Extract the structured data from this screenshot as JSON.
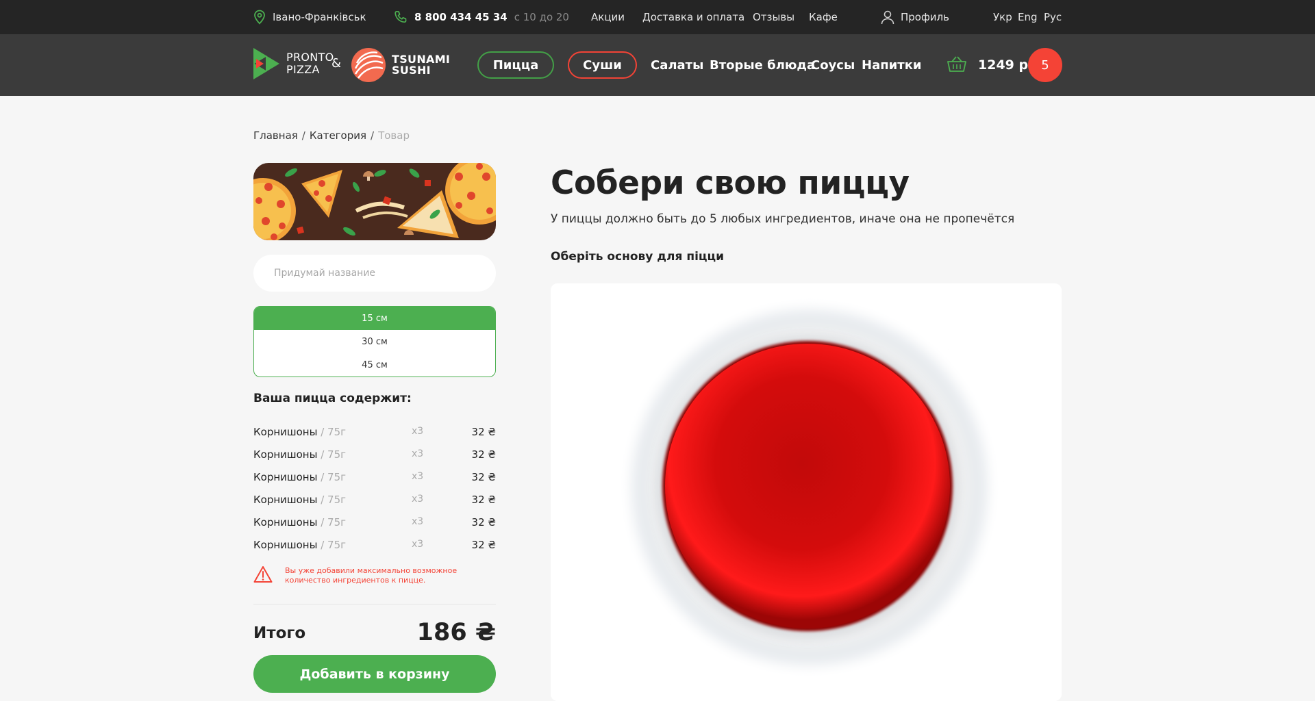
{
  "topbar": {
    "city": "Івано-Франківськ",
    "phone": "8 800 434 45 34",
    "hours": "с 10 до 20",
    "nav": [
      {
        "label": "Акции"
      },
      {
        "label": "Доставка и оплата"
      },
      {
        "label": "Отзывы"
      },
      {
        "label": "Кафе"
      }
    ],
    "profile": "Профиль",
    "languages": [
      "Укр",
      "Eng",
      "Рус"
    ]
  },
  "header": {
    "logo_pronto": [
      "PRONTO",
      "PIZZA"
    ],
    "amp": "&",
    "logo_tsunami": [
      "TSUNAMI",
      "SUSHI"
    ],
    "pill_pizza": "Пицца",
    "pill_sushi": "Суши",
    "nav": [
      {
        "label": "Салаты"
      },
      {
        "label": "Вторые блюда"
      },
      {
        "label": "Соусы"
      },
      {
        "label": "Напитки"
      }
    ],
    "cart_total": "1249 р",
    "cart_count": "5"
  },
  "breadcrumb": {
    "home": "Главная",
    "category": "Категория",
    "current": "Товар",
    "sep": "/"
  },
  "builder": {
    "name_placeholder": "Придумай название",
    "sizes": [
      "15 см",
      "30 см",
      "45 см"
    ],
    "selected_size": "15 см",
    "contains_title": "Ваша пицца содержит:",
    "ingredients": [
      {
        "name": "Корнишоны",
        "weight": " / 75г",
        "qty": "x3",
        "price": "32 ₴"
      },
      {
        "name": "Корнишоны",
        "weight": " / 75г",
        "qty": "x3",
        "price": "32 ₴"
      },
      {
        "name": "Корнишоны",
        "weight": " / 75г",
        "qty": "x3",
        "price": "32 ₴"
      },
      {
        "name": "Корнишоны",
        "weight": " / 75г",
        "qty": "x3",
        "price": "32 ₴"
      },
      {
        "name": "Корнишоны",
        "weight": " / 75г",
        "qty": "x3",
        "price": "32 ₴"
      },
      {
        "name": "Корнишоны",
        "weight": " / 75г",
        "qty": "x3",
        "price": "32 ₴"
      }
    ],
    "warning": "Вы уже добавили максимально возможное количество ингредиентов к пицце.",
    "total_label": "Итого",
    "total_value": "186 ₴",
    "add_button": "Добавить в корзину"
  },
  "main": {
    "title": "Собери свою пиццу",
    "subtitle": "У пиццы должно быть до 5 любых ингредиентов, иначе она не пропечётся",
    "base_title": "Оберіть основу для піцци"
  },
  "colors": {
    "accent_green": "#4caf50",
    "accent_red": "#f44336",
    "topbar_bg": "#252525",
    "header_bg": "#3b3b3b"
  }
}
